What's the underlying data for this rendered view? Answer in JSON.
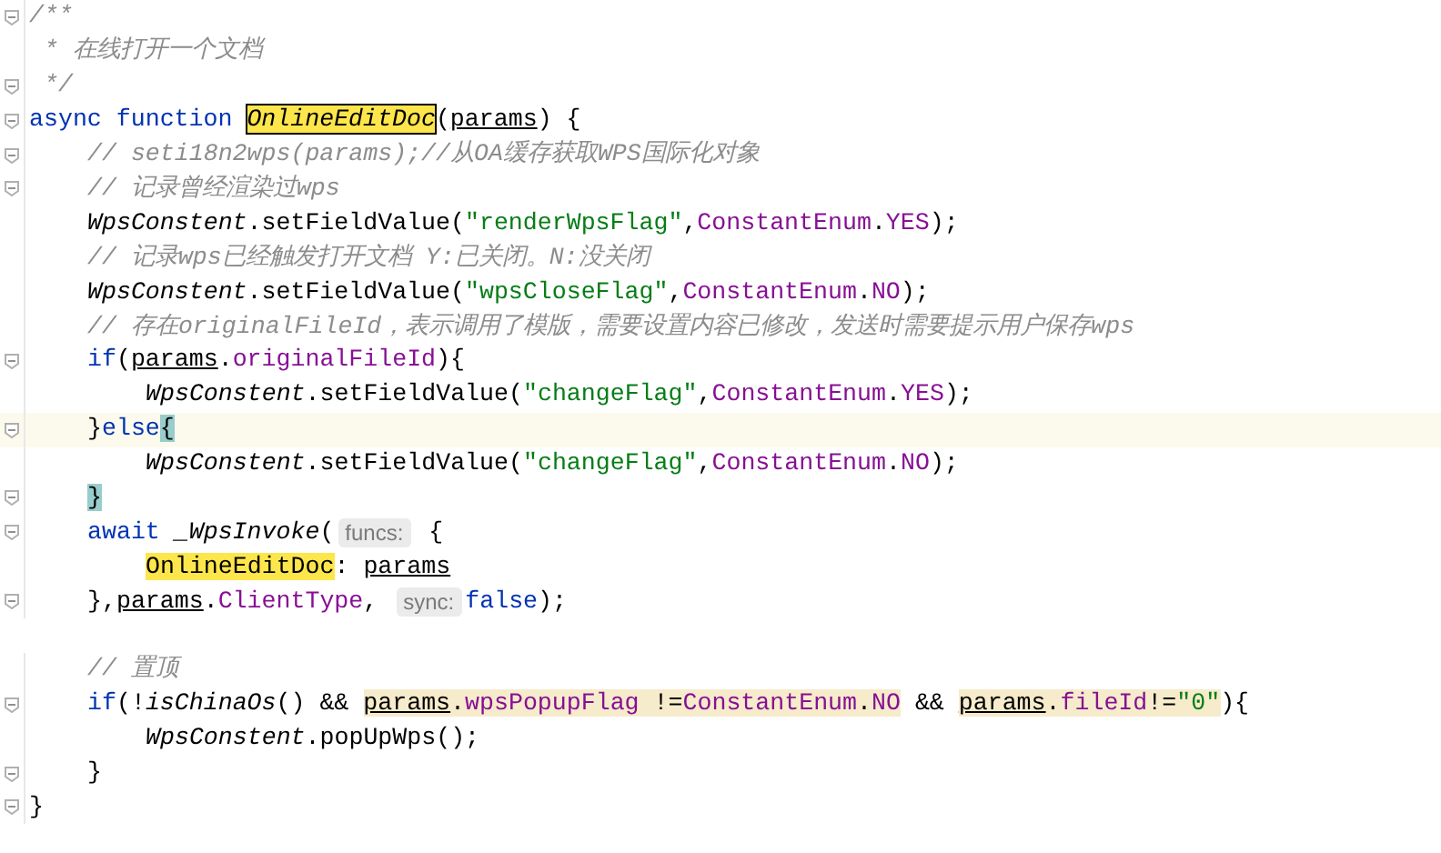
{
  "lines": [
    {
      "kind": "top",
      "fold": true,
      "current": false,
      "tokens": [
        {
          "text": "/**",
          "kind": "comment"
        }
      ]
    },
    {
      "kind": "top",
      "fold": false,
      "current": false,
      "tokens": [
        {
          "text": " * 在线打开一个文档",
          "kind": "comment"
        }
      ]
    },
    {
      "kind": "top",
      "fold": true,
      "current": false,
      "tokens": [
        {
          "text": " */",
          "kind": "comment"
        }
      ]
    },
    {
      "kind": "top",
      "fold": true,
      "current": false,
      "tokens": [
        {
          "text": "async function ",
          "kind": "keyword"
        },
        {
          "text": "OnlineEditDoc",
          "kind": "decl"
        },
        {
          "text": "(",
          "kind": "plain"
        },
        {
          "text": "params",
          "kind": "param"
        },
        {
          "text": ") {",
          "kind": "plain"
        }
      ]
    },
    {
      "kind": "body",
      "fold": true,
      "current": false,
      "tokens": [
        {
          "text": "// seti18n2wps(params);//从OA缓存获取WPS国际化对象",
          "kind": "comment"
        }
      ]
    },
    {
      "kind": "body",
      "fold": true,
      "current": false,
      "tokens": [
        {
          "text": "// 记录曾经渲染过wps",
          "kind": "comment"
        }
      ]
    },
    {
      "kind": "body",
      "fold": false,
      "current": false,
      "tokens": [
        {
          "text": "WpsConstent",
          "kind": "italic"
        },
        {
          "text": ".setFieldValue(",
          "kind": "plain"
        },
        {
          "text": "\"renderWpsFlag\"",
          "kind": "string"
        },
        {
          "text": ",",
          "kind": "plain"
        },
        {
          "text": "ConstantEnum",
          "kind": "field"
        },
        {
          "text": ".",
          "kind": "plain"
        },
        {
          "text": "YES",
          "kind": "field"
        },
        {
          "text": ");",
          "kind": "plain"
        }
      ]
    },
    {
      "kind": "body",
      "fold": false,
      "current": false,
      "tokens": [
        {
          "text": "// 记录wps已经触发打开文档 Y:已关闭。N:没关闭",
          "kind": "comment"
        }
      ]
    },
    {
      "kind": "body",
      "fold": false,
      "current": false,
      "tokens": [
        {
          "text": "WpsConstent",
          "kind": "italic"
        },
        {
          "text": ".setFieldValue(",
          "kind": "plain"
        },
        {
          "text": "\"wpsCloseFlag\"",
          "kind": "string"
        },
        {
          "text": ",",
          "kind": "plain"
        },
        {
          "text": "ConstantEnum",
          "kind": "field"
        },
        {
          "text": ".",
          "kind": "plain"
        },
        {
          "text": "NO",
          "kind": "field"
        },
        {
          "text": ");",
          "kind": "plain"
        }
      ]
    },
    {
      "kind": "body",
      "fold": false,
      "current": false,
      "tokens": [
        {
          "text": "// 存在originalFileId，表示调用了模版，需要设置内容已修改，发送时需要提示用户保存wps",
          "kind": "comment"
        }
      ]
    },
    {
      "kind": "body",
      "fold": true,
      "current": false,
      "tokens": [
        {
          "text": "if",
          "kind": "keyword"
        },
        {
          "text": "(",
          "kind": "plain"
        },
        {
          "text": "params",
          "kind": "param"
        },
        {
          "text": ".",
          "kind": "plain"
        },
        {
          "text": "originalFileId",
          "kind": "field"
        },
        {
          "text": "){",
          "kind": "plain"
        }
      ]
    },
    {
      "kind": "inner",
      "fold": false,
      "current": false,
      "tokens": [
        {
          "text": "WpsConstent",
          "kind": "italic"
        },
        {
          "text": ".setFieldValue(",
          "kind": "plain"
        },
        {
          "text": "\"changeFlag\"",
          "kind": "string"
        },
        {
          "text": ",",
          "kind": "plain"
        },
        {
          "text": "ConstantEnum",
          "kind": "field"
        },
        {
          "text": ".",
          "kind": "plain"
        },
        {
          "text": "YES",
          "kind": "field"
        },
        {
          "text": ");",
          "kind": "plain"
        }
      ]
    },
    {
      "kind": "body",
      "fold": true,
      "current": true,
      "tokens": [
        {
          "text": "}",
          "kind": "plain"
        },
        {
          "text": "else",
          "kind": "keyword"
        },
        {
          "text": "{",
          "kind": "plain",
          "color": "#99cccc"
        }
      ]
    },
    {
      "kind": "inner",
      "fold": false,
      "current": false,
      "tokens": [
        {
          "text": "WpsConstent",
          "kind": "italic"
        },
        {
          "text": ".setFieldValue(",
          "kind": "plain"
        },
        {
          "text": "\"changeFlag\"",
          "kind": "string"
        },
        {
          "text": ",",
          "kind": "plain"
        },
        {
          "text": "ConstantEnum",
          "kind": "field"
        },
        {
          "text": ".",
          "kind": "plain"
        },
        {
          "text": "NO",
          "kind": "field"
        },
        {
          "text": ");",
          "kind": "plain"
        }
      ]
    },
    {
      "kind": "body",
      "fold": true,
      "current": false,
      "tokens": [
        {
          "text": "}",
          "kind": "plain",
          "color": "#99cccc"
        }
      ]
    },
    {
      "kind": "body",
      "fold": true,
      "current": false,
      "tokens": [
        {
          "text": "await ",
          "kind": "keyword"
        },
        {
          "text": "_WpsInvoke",
          "kind": "italic"
        },
        {
          "text": "(",
          "kind": "plain"
        },
        {
          "text": "funcs:",
          "kind": "hint"
        },
        {
          "text": " {",
          "kind": "plain"
        }
      ]
    },
    {
      "kind": "inner",
      "fold": false,
      "current": false,
      "tokens": [
        {
          "text": "OnlineEditDoc",
          "kind": "usage"
        },
        {
          "text": ": ",
          "kind": "plain"
        },
        {
          "text": "params",
          "kind": "param"
        }
      ]
    },
    {
      "kind": "body",
      "fold": true,
      "current": false,
      "tokens": [
        {
          "text": "},",
          "kind": "plain"
        },
        {
          "text": "params",
          "kind": "param"
        },
        {
          "text": ".",
          "kind": "plain"
        },
        {
          "text": "ClientType",
          "kind": "field"
        },
        {
          "text": ", ",
          "kind": "plain"
        },
        {
          "text": "sync:",
          "kind": "hint"
        },
        {
          "text": "false",
          "kind": "keyword"
        },
        {
          "text": ");",
          "kind": "plain"
        }
      ]
    },
    {
      "kind": "blank"
    },
    {
      "kind": "body",
      "fold": false,
      "current": false,
      "tokens": [
        {
          "text": "// 置顶",
          "kind": "comment"
        }
      ]
    },
    {
      "kind": "body",
      "fold": true,
      "current": false,
      "tokens": [
        {
          "text": "if",
          "kind": "keyword"
        },
        {
          "text": "(!",
          "kind": "plain"
        },
        {
          "text": "isChinaOs",
          "kind": "italic"
        },
        {
          "text": "() && ",
          "kind": "plain"
        },
        {
          "text": "params",
          "kind": "param",
          "color": "#f6ebcb"
        },
        {
          "text": ".",
          "kind": "plain",
          "color": "#f6ebcb"
        },
        {
          "text": "wpsPopupFlag",
          "kind": "field",
          "color": "#f6ebcb"
        },
        {
          "text": " !=",
          "kind": "plain",
          "color": "#f6ebcb"
        },
        {
          "text": "ConstantEnum",
          "kind": "field",
          "color": "#f6ebcb"
        },
        {
          "text": ".",
          "kind": "plain",
          "color": "#f6ebcb"
        },
        {
          "text": "NO",
          "kind": "field",
          "color": "#f6ebcb"
        },
        {
          "text": " && ",
          "kind": "plain"
        },
        {
          "text": "params",
          "kind": "param",
          "color": "#f6ebcb"
        },
        {
          "text": ".",
          "kind": "plain",
          "color": "#f6ebcb"
        },
        {
          "text": "fileId",
          "kind": "field",
          "color": "#f6ebcb"
        },
        {
          "text": "!=",
          "kind": "plain",
          "color": "#f6ebcb"
        },
        {
          "text": "\"0\"",
          "kind": "string",
          "color": "#f6ebcb"
        },
        {
          "text": "){",
          "kind": "plain"
        }
      ]
    },
    {
      "kind": "inner",
      "fold": false,
      "current": false,
      "tokens": [
        {
          "text": "WpsConstent",
          "kind": "italic"
        },
        {
          "text": ".popUpWps();",
          "kind": "plain"
        }
      ]
    },
    {
      "kind": "body",
      "fold": true,
      "current": false,
      "tokens": [
        {
          "text": "}",
          "kind": "plain"
        }
      ]
    },
    {
      "kind": "top",
      "fold": true,
      "current": false,
      "tokens": [
        {
          "text": "}",
          "kind": "plain"
        }
      ]
    }
  ]
}
